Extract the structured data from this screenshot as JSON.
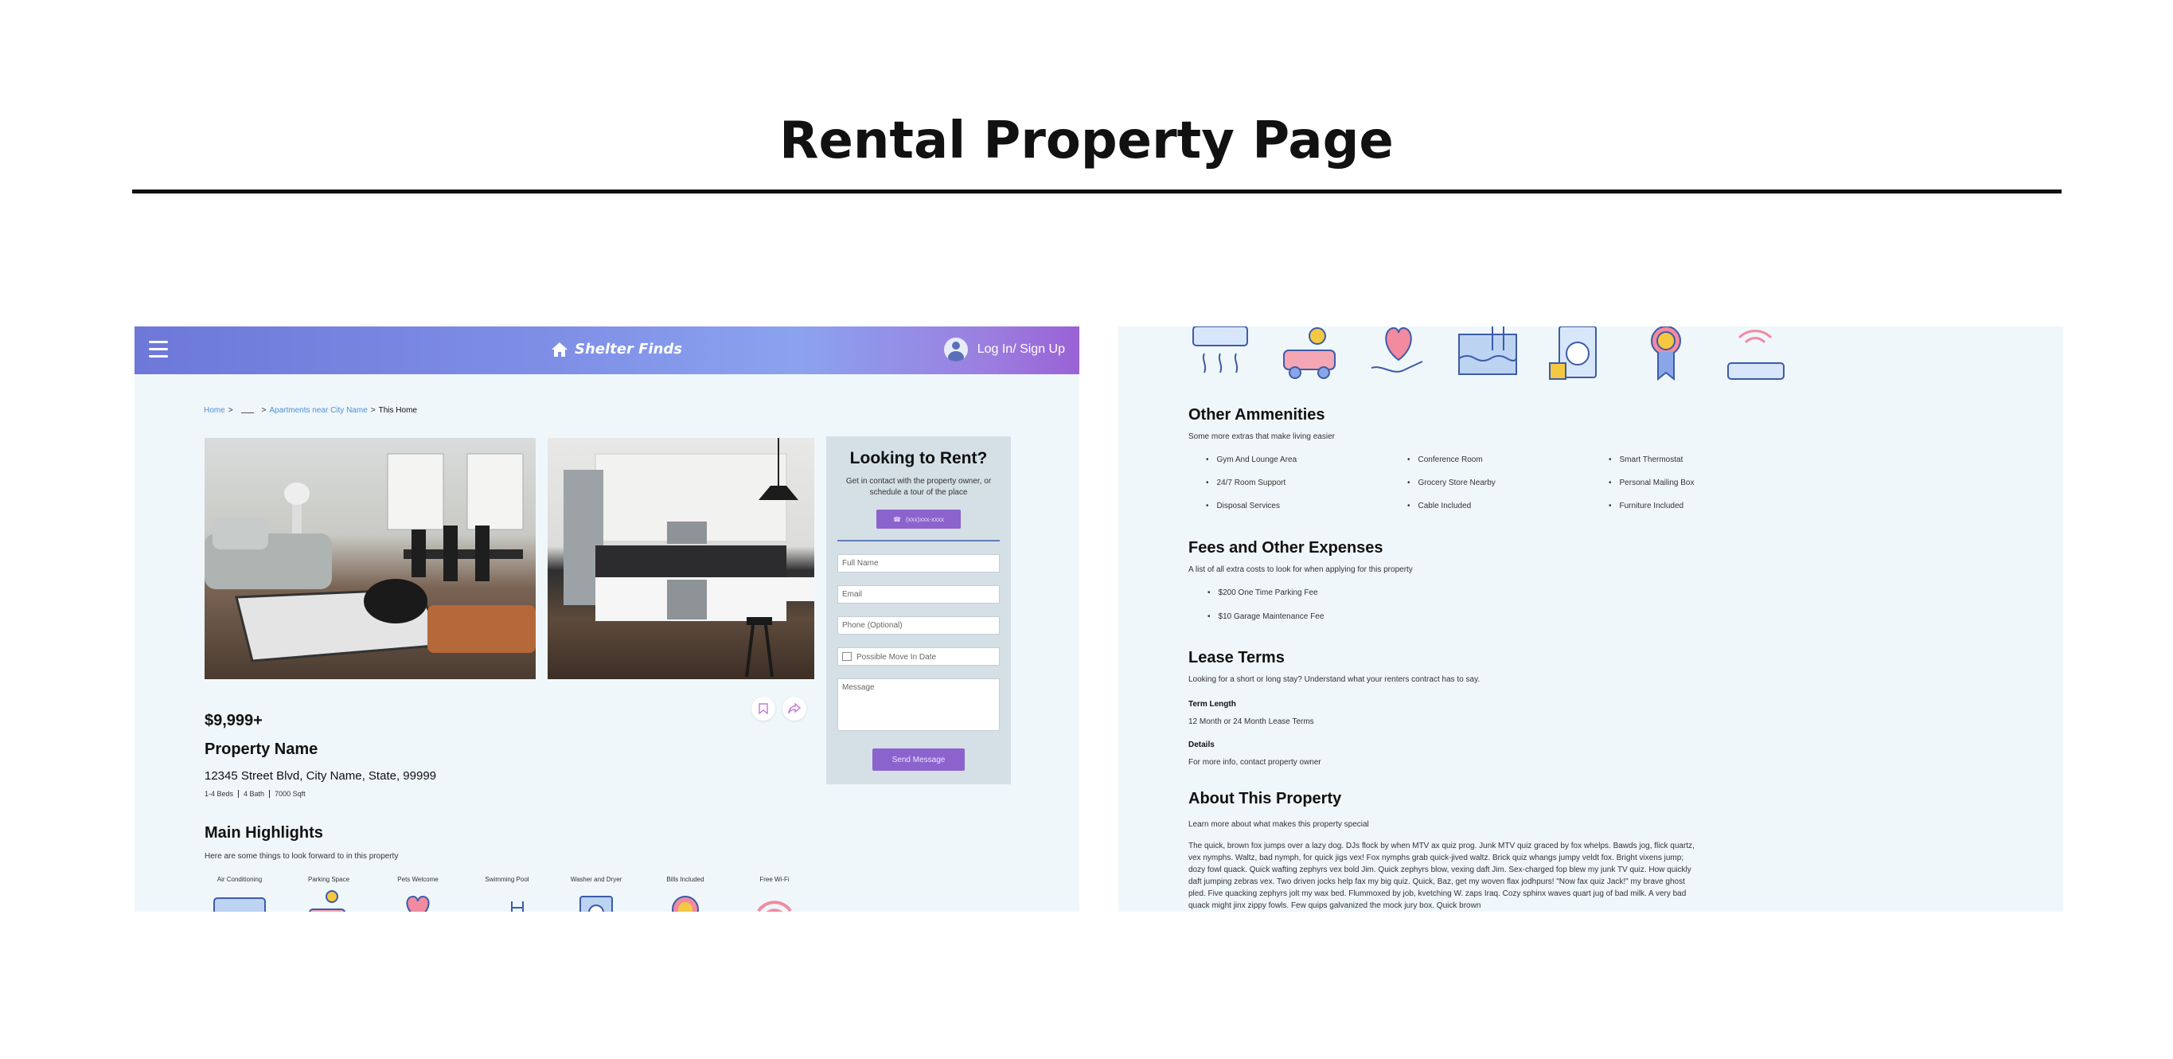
{
  "page_title": "Rental Property Page",
  "left": {
    "brand": "Shelter Finds",
    "login_label": "Log In/ Sign Up",
    "breadcrumb": {
      "home": "Home",
      "sep1": ">",
      "sep2": ">",
      "listing": "Apartments near City Name",
      "sep3": ">",
      "current": "This Home"
    },
    "form": {
      "title": "Looking to Rent?",
      "description": "Get in contact with the property owner, or schedule a tour of the place",
      "phone": "(xxx)xxx-xxxx",
      "full_name": "Full Name",
      "email": "Email",
      "phone_optional": "Phone (Optional)",
      "move_in": "Possible Move In Date",
      "message": "Message",
      "send": "Send Message"
    },
    "price": "$9,999+",
    "property_name": "Property Name",
    "address": "12345 Street Blvd, City Name, State, 99999",
    "specs": [
      "1-4 Beds",
      "4 Bath",
      "7000 Sqft"
    ],
    "highlights": {
      "title": "Main Highlights",
      "subtitle": "Here are some things to look forward to in this property",
      "items": [
        "Air Conditioning",
        "Parking Space",
        "Pets Welcome",
        "Swimming Pool",
        "Washer and Dryer",
        "Bills Included",
        "Free Wi-Fi"
      ]
    }
  },
  "right": {
    "other": {
      "title": "Other Ammenities",
      "subtitle": "Some more extras that make living easier",
      "items": [
        "Gym And Lounge Area",
        "Conference Room",
        "Smart Thermostat",
        "24/7 Room Support",
        "Grocery Store Nearby",
        "Personal Mailing Box",
        "Disposal Services",
        "Cable Included",
        "Furniture Included"
      ]
    },
    "fees": {
      "title": "Fees and Other Expenses",
      "subtitle": "A list of all extra costs to look for when applying for this property",
      "items": [
        "$200 One Time Parking Fee",
        "$10 Garage Maintenance Fee"
      ]
    },
    "lease": {
      "title": "Lease Terms",
      "subtitle": "Looking for a short or long stay? Understand what your renters contract has to say.",
      "term_label": "Term Length",
      "term_value": "12 Month or 24 Month Lease Terms",
      "details_label": "Details",
      "details_value": "For more info, contact property owner"
    },
    "about": {
      "title": "About This Property",
      "subtitle": "Learn more about what makes this property special",
      "paragraph": "The quick, brown fox jumps over a lazy dog. DJs flock by when MTV ax quiz prog. Junk MTV quiz graced by fox whelps. Bawds jog, flick quartz, vex nymphs. Waltz, bad nymph, for quick jigs vex! Fox nymphs grab quick-jived waltz. Brick quiz whangs jumpy veldt fox. Bright vixens jump; dozy fowl quack. Quick wafting zephyrs vex bold Jim. Quick zephyrs blow, vexing daft Jim. Sex-charged fop blew my junk TV quiz. How quickly daft jumping zebras vex. Two driven jocks help fax my big quiz. Quick, Baz, get my woven flax jodhpurs! \"Now fax quiz Jack!\" my brave ghost pled. Five quacking zephyrs jolt my wax bed. Flummoxed by job, kvetching W. zaps Iraq. Cozy sphinx waves quart jug of bad milk. A very bad quack might jinx zippy fowls. Few quips galvanized the mock jury box. Quick brown"
    }
  }
}
